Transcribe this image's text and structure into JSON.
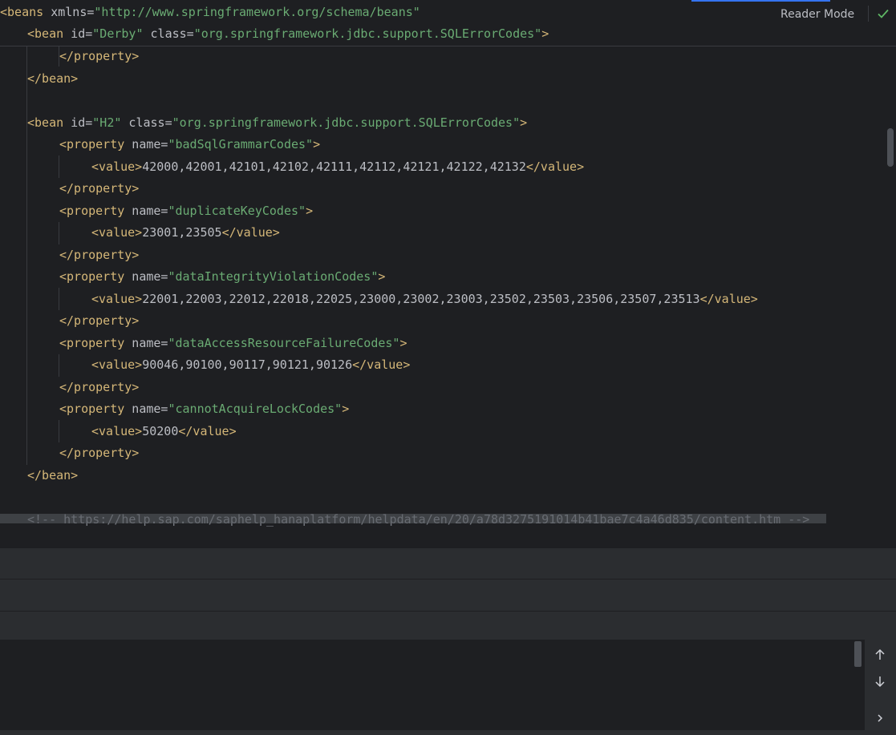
{
  "toolbar": {
    "reader_mode": "Reader Mode",
    "status_icon": "check-icon"
  },
  "code": {
    "beans_open": {
      "tag": "<beans",
      "attr": " xmlns=",
      "value": "\"http://www.springframework.org/schema/beans\""
    },
    "bean_derby": {
      "tag": "<bean",
      "attr1": " id=",
      "id": "\"Derby\"",
      "attr2": " class=",
      "class": "\"org.springframework.jdbc.support.SQLErrorCodes\"",
      "close": ">"
    },
    "property_close": "</property>",
    "bean_close": "</bean>",
    "bean_h2": {
      "tag": "<bean",
      "attr1": " id=",
      "id": "\"H2\"",
      "attr2": " class=",
      "class": "\"org.springframework.jdbc.support.SQLErrorCodes\"",
      "close": ">"
    },
    "property_tag": "<property",
    "name_attr": " name=",
    "value_open": "<value>",
    "value_close": "</value>",
    "gt": ">",
    "properties": [
      {
        "name": "\"badSqlGrammarCodes\"",
        "value": "42000,42001,42101,42102,42111,42112,42121,42122,42132"
      },
      {
        "name": "\"duplicateKeyCodes\"",
        "value": "23001,23505"
      },
      {
        "name": "\"dataIntegrityViolationCodes\"",
        "value": "22001,22003,22012,22018,22025,23000,23002,23003,23502,23503,23506,23507,23513"
      },
      {
        "name": "\"dataAccessResourceFailureCodes\"",
        "value": "90046,90100,90117,90121,90126"
      },
      {
        "name": "\"cannotAcquireLockCodes\"",
        "value": "50200"
      }
    ],
    "comment": "<!-- https://help.sap.com/saphelp_hanaplatform/helpdata/en/20/a78d3275191014b41bae7c4a46d835/content.htm -->"
  },
  "bottom_panel": {
    "nav_up_icon": "arrow-up-icon",
    "nav_down_icon": "arrow-down-icon",
    "expand_icon": "chevron-right-icon"
  },
  "colors": {
    "background": "#1e1f22",
    "panel": "#2b2d30",
    "tag": "#d5b778",
    "attribute": "#bcbec4",
    "string": "#6aab73",
    "comment": "#7a7e85",
    "accent": "#3574f0",
    "success": "#5fb865"
  }
}
